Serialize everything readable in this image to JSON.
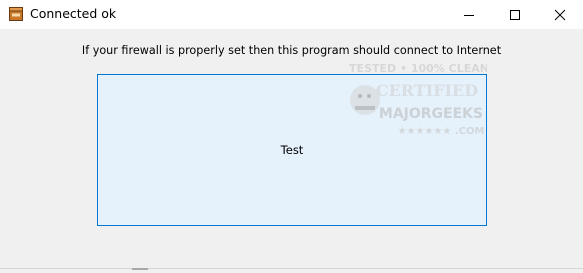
{
  "window": {
    "title": "Connected ok",
    "icon": "app-box-icon",
    "controls": {
      "minimize": "minimize-icon",
      "maximize": "maximize-icon",
      "close": "close-icon"
    }
  },
  "main": {
    "instruction": "If your firewall is properly set then this program should connect to Internet",
    "test_button_label": "Test"
  },
  "watermark": {
    "line1": "TESTED • 100% CLEAN",
    "line2": "CERTIFIED",
    "line3": "MAJORGEEKS",
    "line4": "★★★★★★ .COM"
  },
  "colors": {
    "button_fill": "#e5f1fb",
    "button_border": "#0078d7",
    "window_bg": "#f0f0f0"
  }
}
